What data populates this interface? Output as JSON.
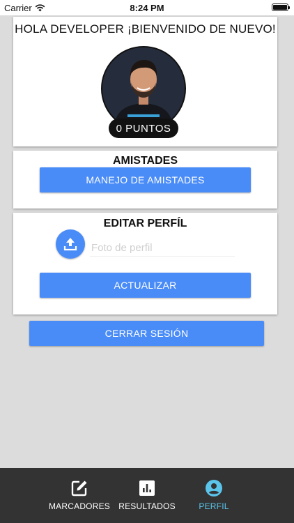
{
  "status_bar": {
    "carrier": "Carrier",
    "time": "8:24 PM"
  },
  "profile": {
    "greeting": "HOLA DEVELOPER ¡BIENVENIDO DE NUEVO!",
    "points": "0 PUNTOS"
  },
  "friends": {
    "title": "AMISTADES",
    "manage_label": "MANEJO DE AMISTADES"
  },
  "edit_profile": {
    "title": "EDITAR PERFÍL",
    "photo_placeholder": "Foto de perfil",
    "photo_value": "",
    "update_label": "ACTUALIZAR"
  },
  "logout_label": "CERRAR SESIÓN",
  "tabs": [
    {
      "label": "MARCADORES",
      "icon": "edit-icon",
      "active": false
    },
    {
      "label": "RESULTADOS",
      "icon": "bar-chart-icon",
      "active": false
    },
    {
      "label": "PERFIL",
      "icon": "account-icon",
      "active": true
    }
  ],
  "colors": {
    "primary": "#4a8cf7",
    "tab_bar": "#333333",
    "tab_active": "#5bc4ea",
    "background": "#dcdcdc"
  }
}
